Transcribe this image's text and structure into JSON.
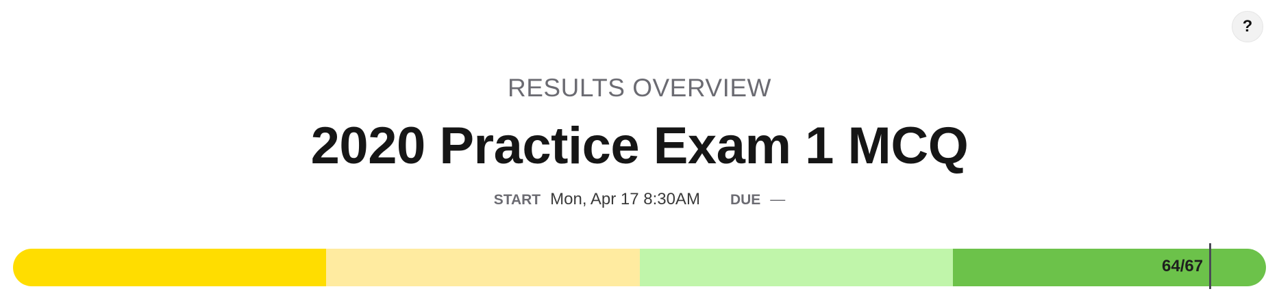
{
  "help": {
    "label": "?"
  },
  "header": {
    "overview_label": "RESULTS OVERVIEW",
    "title": "2020 Practice Exam 1 MCQ"
  },
  "meta": {
    "start_label": "START",
    "start_value": "Mon, Apr 17 8:30AM",
    "due_label": "DUE",
    "due_value": "—"
  },
  "progress": {
    "score_text": "64/67",
    "score": 64,
    "total": 67,
    "segments": [
      {
        "name": "segment-1",
        "color": "#FFDD00"
      },
      {
        "name": "segment-2",
        "color": "#FFEBA0"
      },
      {
        "name": "segment-3",
        "color": "#C0F5AA"
      },
      {
        "name": "segment-4",
        "color": "#6CC24A"
      }
    ]
  }
}
